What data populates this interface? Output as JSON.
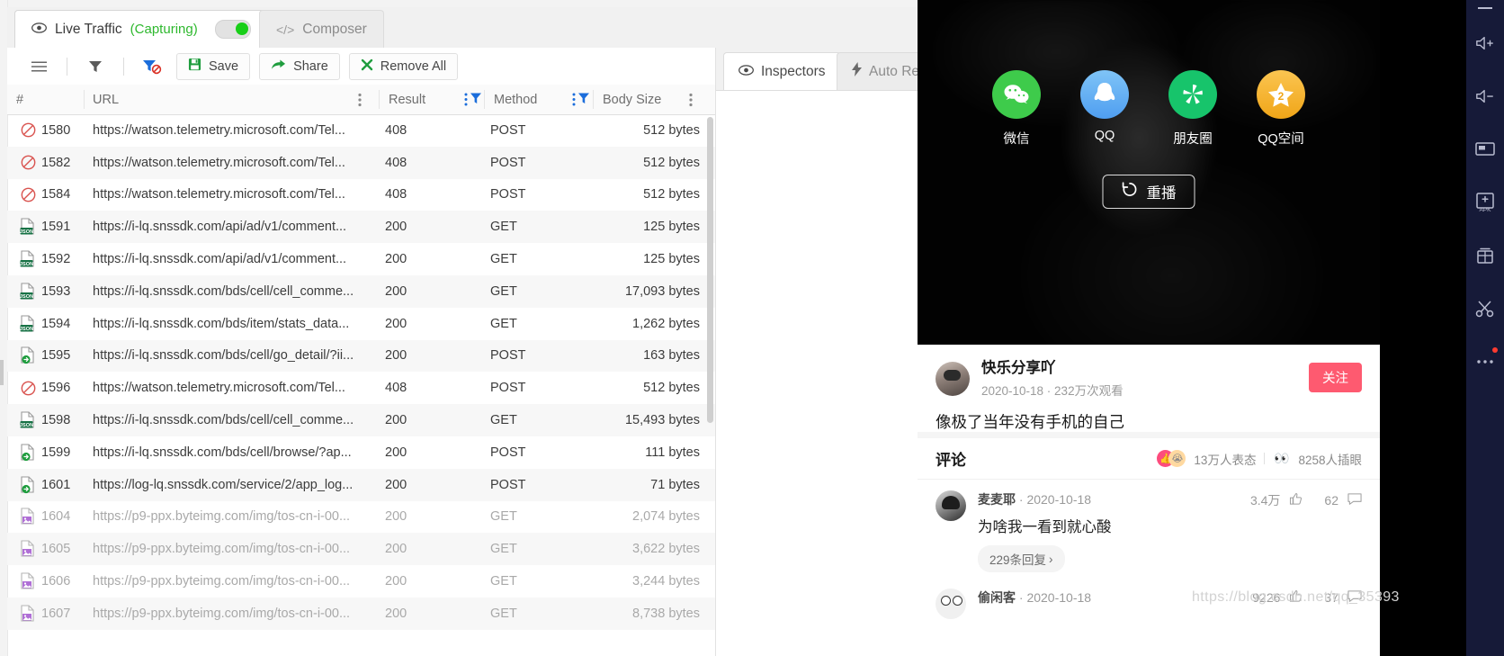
{
  "fiddler": {
    "tabs": [
      {
        "id": "live",
        "icon": "eye-icon",
        "label": "Live Traffic",
        "status": "(Capturing)",
        "active": true
      },
      {
        "id": "composer",
        "icon": "code-icon",
        "label": "Composer",
        "active": false
      }
    ],
    "toolbar": {
      "menu_icon": "hamburger-icon",
      "filter_icon": "filter-icon",
      "clear_filter_icon": "filter-off-icon",
      "save_label": "Save",
      "share_label": "Share",
      "remove_all_label": "Remove All"
    },
    "grid": {
      "columns": [
        {
          "key": "num",
          "label": "#"
        },
        {
          "key": "url",
          "label": "URL"
        },
        {
          "key": "result",
          "label": "Result"
        },
        {
          "key": "method",
          "label": "Method"
        },
        {
          "key": "size",
          "label": "Body Size"
        }
      ],
      "rows": [
        {
          "icon": "blocked-icon",
          "num": "1580",
          "url": "https://watson.telemetry.microsoft.com/Tel...",
          "result": "408",
          "method": "POST",
          "size": "512 bytes",
          "dim": false
        },
        {
          "icon": "blocked-icon",
          "num": "1582",
          "url": "https://watson.telemetry.microsoft.com/Tel...",
          "result": "408",
          "method": "POST",
          "size": "512 bytes",
          "dim": false
        },
        {
          "icon": "blocked-icon",
          "num": "1584",
          "url": "https://watson.telemetry.microsoft.com/Tel...",
          "result": "408",
          "method": "POST",
          "size": "512 bytes",
          "dim": false
        },
        {
          "icon": "json-file-icon",
          "num": "1591",
          "url": "https://i-lq.snssdk.com/api/ad/v1/comment...",
          "result": "200",
          "method": "GET",
          "size": "125 bytes",
          "dim": false
        },
        {
          "icon": "json-file-icon",
          "num": "1592",
          "url": "https://i-lq.snssdk.com/api/ad/v1/comment...",
          "result": "200",
          "method": "GET",
          "size": "125 bytes",
          "dim": false
        },
        {
          "icon": "json-file-icon",
          "num": "1593",
          "url": "https://i-lq.snssdk.com/bds/cell/cell_comme...",
          "result": "200",
          "method": "GET",
          "size": "17,093 bytes",
          "dim": false
        },
        {
          "icon": "json-file-icon",
          "num": "1594",
          "url": "https://i-lq.snssdk.com/bds/item/stats_data...",
          "result": "200",
          "method": "GET",
          "size": "1,262 bytes",
          "dim": false
        },
        {
          "icon": "post-file-icon",
          "num": "1595",
          "url": "https://i-lq.snssdk.com/bds/cell/go_detail/?ii...",
          "result": "200",
          "method": "POST",
          "size": "163 bytes",
          "dim": false
        },
        {
          "icon": "blocked-icon",
          "num": "1596",
          "url": "https://watson.telemetry.microsoft.com/Tel...",
          "result": "408",
          "method": "POST",
          "size": "512 bytes",
          "dim": false
        },
        {
          "icon": "json-file-icon",
          "num": "1598",
          "url": "https://i-lq.snssdk.com/bds/cell/cell_comme...",
          "result": "200",
          "method": "GET",
          "size": "15,493 bytes",
          "dim": false
        },
        {
          "icon": "post-file-icon",
          "num": "1599",
          "url": "https://i-lq.snssdk.com/bds/cell/browse/?ap...",
          "result": "200",
          "method": "POST",
          "size": "111 bytes",
          "dim": false
        },
        {
          "icon": "post-file-icon",
          "num": "1601",
          "url": "https://log-lq.snssdk.com/service/2/app_log...",
          "result": "200",
          "method": "POST",
          "size": "71 bytes",
          "dim": false
        },
        {
          "icon": "image-file-icon",
          "num": "1604",
          "url": "https://p9-ppx.byteimg.com/img/tos-cn-i-00...",
          "result": "200",
          "method": "GET",
          "size": "2,074 bytes",
          "dim": true
        },
        {
          "icon": "image-file-icon",
          "num": "1605",
          "url": "https://p9-ppx.byteimg.com/img/tos-cn-i-00...",
          "result": "200",
          "method": "GET",
          "size": "3,622 bytes",
          "dim": true
        },
        {
          "icon": "image-file-icon",
          "num": "1606",
          "url": "https://p9-ppx.byteimg.com/img/tos-cn-i-00...",
          "result": "200",
          "method": "GET",
          "size": "3,244 bytes",
          "dim": true
        },
        {
          "icon": "image-file-icon",
          "num": "1607",
          "url": "https://p9-ppx.byteimg.com/img/tos-cn-i-00...",
          "result": "200",
          "method": "GET",
          "size": "8,738 bytes",
          "dim": true
        }
      ]
    },
    "right_tabs": [
      {
        "id": "inspectors",
        "icon": "eye-icon",
        "label": "Inspectors",
        "active": true
      },
      {
        "id": "autoresponder",
        "icon": "bolt-icon",
        "label": "Auto Re",
        "active": false
      }
    ]
  },
  "phone": {
    "share_items": [
      {
        "label": "微信",
        "icon": "wechat-icon",
        "color": "#3ecb4b"
      },
      {
        "label": "QQ",
        "icon": "qq-icon",
        "color": "#50a8f0"
      },
      {
        "label": "朋友圈",
        "icon": "moments-icon",
        "color": "#17c46b"
      },
      {
        "label": "QQ空间",
        "icon": "qzone-icon",
        "color": "#f5b124"
      }
    ],
    "replay_label": "重播",
    "replay_icon": "replay-icon",
    "video": {
      "author": "快乐分享吖",
      "meta": "2020-10-18 · 232万次观看",
      "title": "像极了当年没有手机的自己",
      "follow_label": "关注",
      "follow_color": "#fe5a70",
      "avatar": "author-avatar"
    },
    "comments_header": {
      "title": "评论",
      "reaction_emoji_1": "👍",
      "reaction_emoji_2": "😭",
      "reaction_text": "13万人表态",
      "watch_emoji": "👀",
      "watch_text": "8258人插眼"
    },
    "comments": [
      {
        "avatar": "commenter-avatar-1",
        "name": "麦麦耶",
        "date": "2020-10-18",
        "text": "为啥我一看到就心酸",
        "replies": "229条回复",
        "likes": "3.4万",
        "like_icon": "thumbs-up-icon",
        "comment_count": "62",
        "comment_icon": "comment-icon"
      },
      {
        "avatar": "commenter-avatar-2",
        "name": "偷闲客",
        "date": "2020-10-18",
        "text": "",
        "replies": "",
        "likes": "9226",
        "like_icon": "thumbs-up-icon",
        "comment_count": "37",
        "comment_icon": "comment-icon"
      }
    ]
  },
  "emulator_sidebar": {
    "items": [
      {
        "icon": "volume-up-icon"
      },
      {
        "icon": "volume-down-icon"
      },
      {
        "icon": "screenshot-icon"
      },
      {
        "icon": "install-apk-icon"
      },
      {
        "icon": "file-manager-icon"
      },
      {
        "icon": "scissors-icon"
      },
      {
        "icon": "more-icon",
        "badge": true
      }
    ]
  },
  "watermark": "https://blog.csdn.net/qq_35393"
}
